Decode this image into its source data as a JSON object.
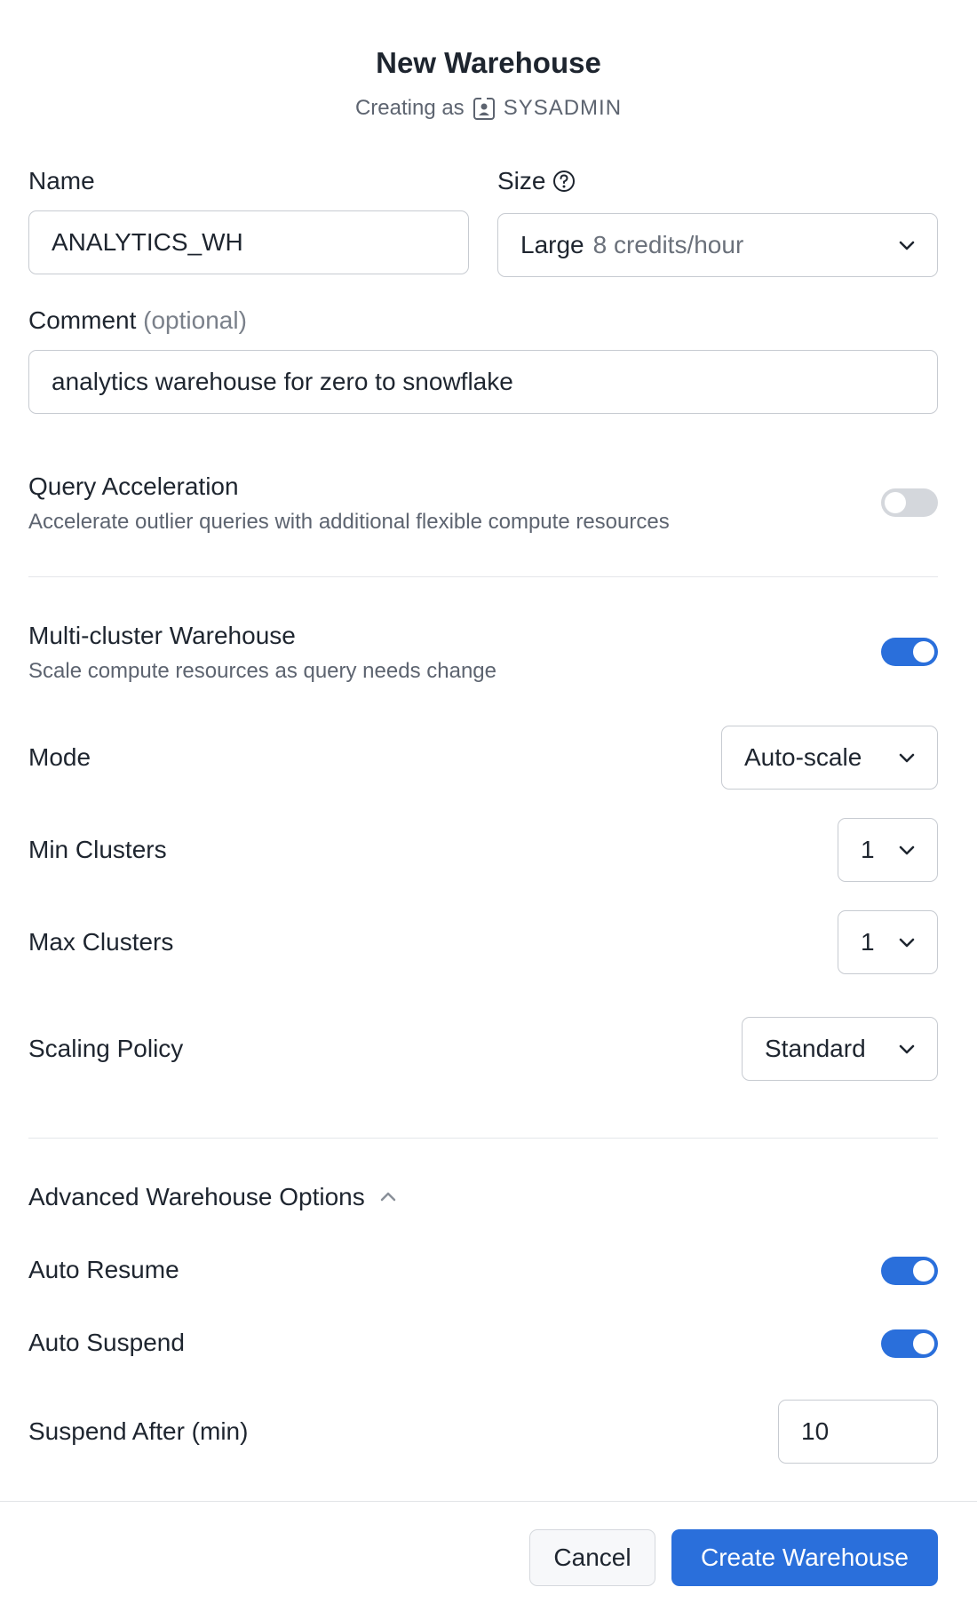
{
  "header": {
    "title": "New Warehouse",
    "creating_as_label": "Creating as",
    "role": "SYSADMIN",
    "role_icon": "user-badge-icon"
  },
  "name_field": {
    "label": "Name",
    "value": "ANALYTICS_WH"
  },
  "size_field": {
    "label": "Size",
    "help_icon": "question-circle-icon",
    "value": "Large",
    "credits": "8 credits/hour"
  },
  "comment_field": {
    "label": "Comment",
    "optional_label": "(optional)",
    "value": "analytics warehouse for zero to snowflake"
  },
  "query_acceleration": {
    "title": "Query Acceleration",
    "description": "Accelerate outlier queries with additional flexible compute resources",
    "enabled": false
  },
  "multi_cluster": {
    "title": "Multi-cluster Warehouse",
    "description": "Scale compute resources as query needs change",
    "enabled": true,
    "mode": {
      "label": "Mode",
      "value": "Auto-scale"
    },
    "min_clusters": {
      "label": "Min Clusters",
      "value": "1"
    },
    "max_clusters": {
      "label": "Max Clusters",
      "value": "1"
    },
    "scaling_policy": {
      "label": "Scaling Policy",
      "value": "Standard"
    }
  },
  "advanced": {
    "title": "Advanced Warehouse Options",
    "expanded": true,
    "auto_resume": {
      "label": "Auto Resume",
      "enabled": true
    },
    "auto_suspend": {
      "label": "Auto Suspend",
      "enabled": true
    },
    "suspend_after": {
      "label": "Suspend After (min)",
      "value": "10"
    }
  },
  "footer": {
    "cancel_label": "Cancel",
    "create_label": "Create Warehouse"
  },
  "colors": {
    "accent": "#2a6fdb",
    "toggle_off": "#d4d7dc",
    "text": "#1e252f",
    "muted_text": "#5d6470"
  }
}
